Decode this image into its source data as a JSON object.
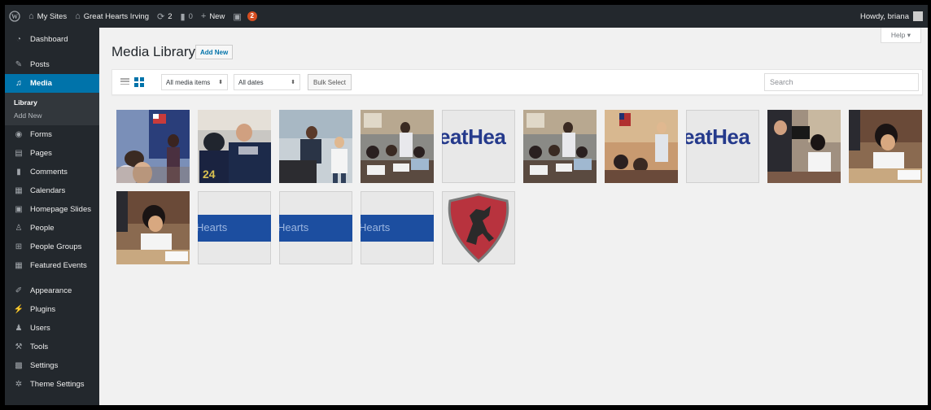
{
  "admin_bar": {
    "my_sites": "My Sites",
    "site_name": "Great Hearts Irving",
    "updates_count": "2",
    "comments_count": "0",
    "new_label": "New",
    "notification_count": "2",
    "howdy": "Howdy, briana"
  },
  "sidebar": {
    "items": [
      {
        "label": "Dashboard",
        "icon": "dashboard-icon"
      },
      {
        "label": "Posts",
        "icon": "pin-icon"
      },
      {
        "label": "Media",
        "icon": "media-icon"
      },
      {
        "label": "Forms",
        "icon": "forms-icon"
      },
      {
        "label": "Pages",
        "icon": "pages-icon"
      },
      {
        "label": "Comments",
        "icon": "comment-icon"
      },
      {
        "label": "Calendars",
        "icon": "calendar-icon"
      },
      {
        "label": "Homepage Slides",
        "icon": "slides-icon"
      },
      {
        "label": "People",
        "icon": "people-icon"
      },
      {
        "label": "People Groups",
        "icon": "groups-icon"
      },
      {
        "label": "Featured Events",
        "icon": "events-icon"
      },
      {
        "label": "Appearance",
        "icon": "brush-icon"
      },
      {
        "label": "Plugins",
        "icon": "plugin-icon"
      },
      {
        "label": "Users",
        "icon": "users-icon"
      },
      {
        "label": "Tools",
        "icon": "wrench-icon"
      },
      {
        "label": "Settings",
        "icon": "settings-icon"
      },
      {
        "label": "Theme Settings",
        "icon": "gear-icon"
      }
    ],
    "media_sub": {
      "library": "Library",
      "add_new": "Add New"
    }
  },
  "main": {
    "help": "Help ▾",
    "title": "Media Library",
    "add_new": "Add New",
    "filter_media": "All media items",
    "filter_dates": "All dates",
    "bulk_select": "Bulk Select",
    "search_placeholder": "Search"
  },
  "media_items": [
    {
      "kind": "photo",
      "scene": "classroom-flag-students"
    },
    {
      "kind": "photo",
      "scene": "football-players"
    },
    {
      "kind": "photo",
      "scene": "teacher-with-child"
    },
    {
      "kind": "photo",
      "scene": "students-at-tables"
    },
    {
      "kind": "logo",
      "text": "eatHea"
    },
    {
      "kind": "photo",
      "scene": "students-at-tables"
    },
    {
      "kind": "photo",
      "scene": "teacher-in-classroom"
    },
    {
      "kind": "logo",
      "text": "eatHea"
    },
    {
      "kind": "photo",
      "scene": "classroom-camera"
    },
    {
      "kind": "photo",
      "scene": "girl-writing"
    },
    {
      "kind": "photo",
      "scene": "girl-writing"
    },
    {
      "kind": "banner",
      "text": "Hearts"
    },
    {
      "kind": "banner",
      "text": "Hearts"
    },
    {
      "kind": "banner",
      "text": "Hearts"
    },
    {
      "kind": "crest",
      "scene": "red-crest-horse"
    }
  ],
  "colors": {
    "admin_bg": "#23282d",
    "accent": "#0073aa",
    "bubble": "#d54e21",
    "content_bg": "#f1f1f1"
  }
}
